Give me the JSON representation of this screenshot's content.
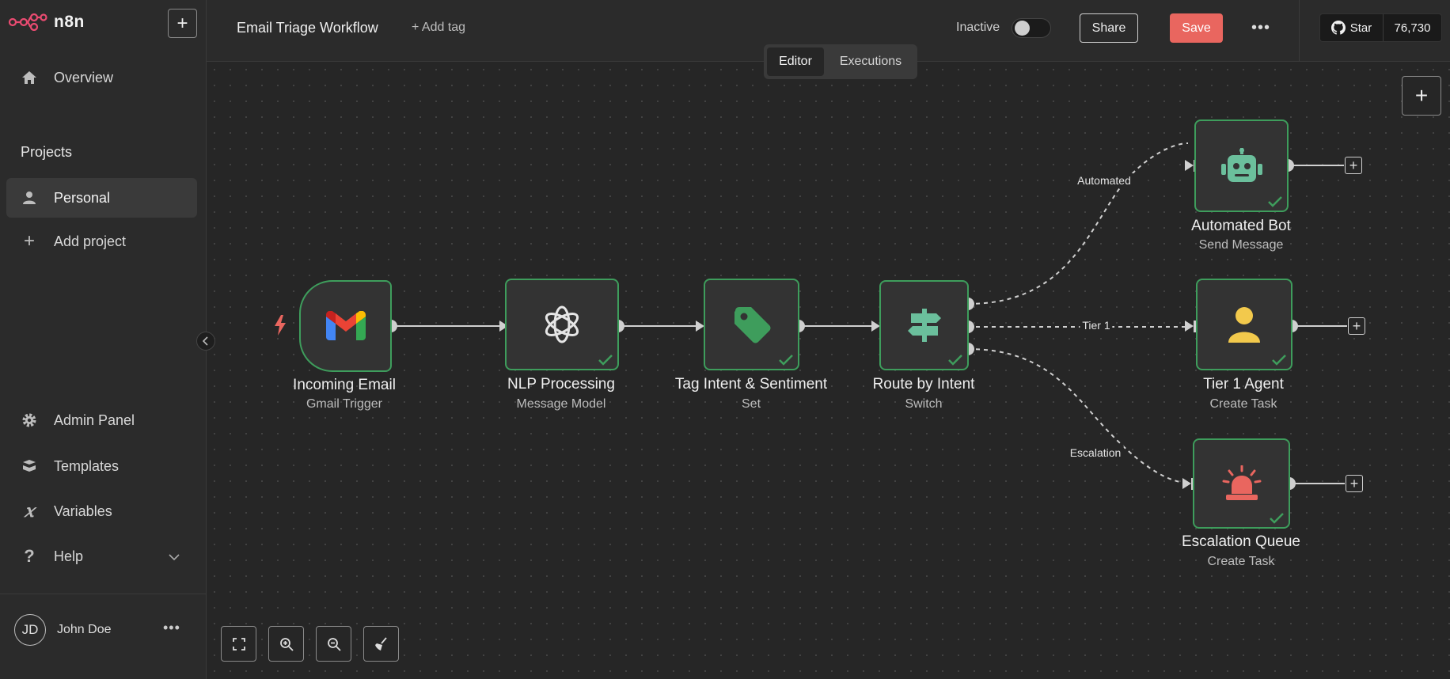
{
  "app": {
    "logo_text": "n8n"
  },
  "sidebar": {
    "overview": "Overview",
    "projects_title": "Projects",
    "personal": "Personal",
    "add_project": "Add project",
    "admin_panel": "Admin Panel",
    "templates": "Templates",
    "variables": "Variables",
    "help": "Help",
    "user": {
      "initials": "JD",
      "name": "John Doe"
    }
  },
  "header": {
    "workflow_title": "Email Triage Workflow",
    "add_tag": "+ Add tag",
    "status": "Inactive",
    "share": "Share",
    "save": "Save",
    "github_star": "Star",
    "github_count": "76,730",
    "tabs": [
      {
        "label": "Editor",
        "active": true
      },
      {
        "label": "Executions",
        "active": false
      }
    ]
  },
  "nodes": [
    {
      "label": "Incoming Email",
      "sub": "Gmail Trigger",
      "icon": "gmail-icon"
    },
    {
      "label": "NLP Processing",
      "sub": "Message Model",
      "icon": "openai-icon"
    },
    {
      "label": "Tag Intent & Sentiment",
      "sub": "Set",
      "icon": "tag-icon"
    },
    {
      "label": "Route by Intent",
      "sub": "Switch",
      "icon": "signpost-icon"
    },
    {
      "label": "Automated Bot",
      "sub": "Send Message",
      "icon": "robot-icon"
    },
    {
      "label": "Tier 1 Agent",
      "sub": "Create Task",
      "icon": "user-icon"
    },
    {
      "label": "Escalation Queue",
      "sub": "Create Task",
      "icon": "siren-icon"
    }
  ],
  "wire_labels": {
    "automated": "Automated",
    "tier1": "Tier 1",
    "escalation": "Escalation"
  },
  "colors": {
    "accent": "#e9665f",
    "node_border": "#3e9d5c",
    "robot": "#6bbf9c",
    "user": "#f2c94c",
    "siren": "#e9665f"
  }
}
